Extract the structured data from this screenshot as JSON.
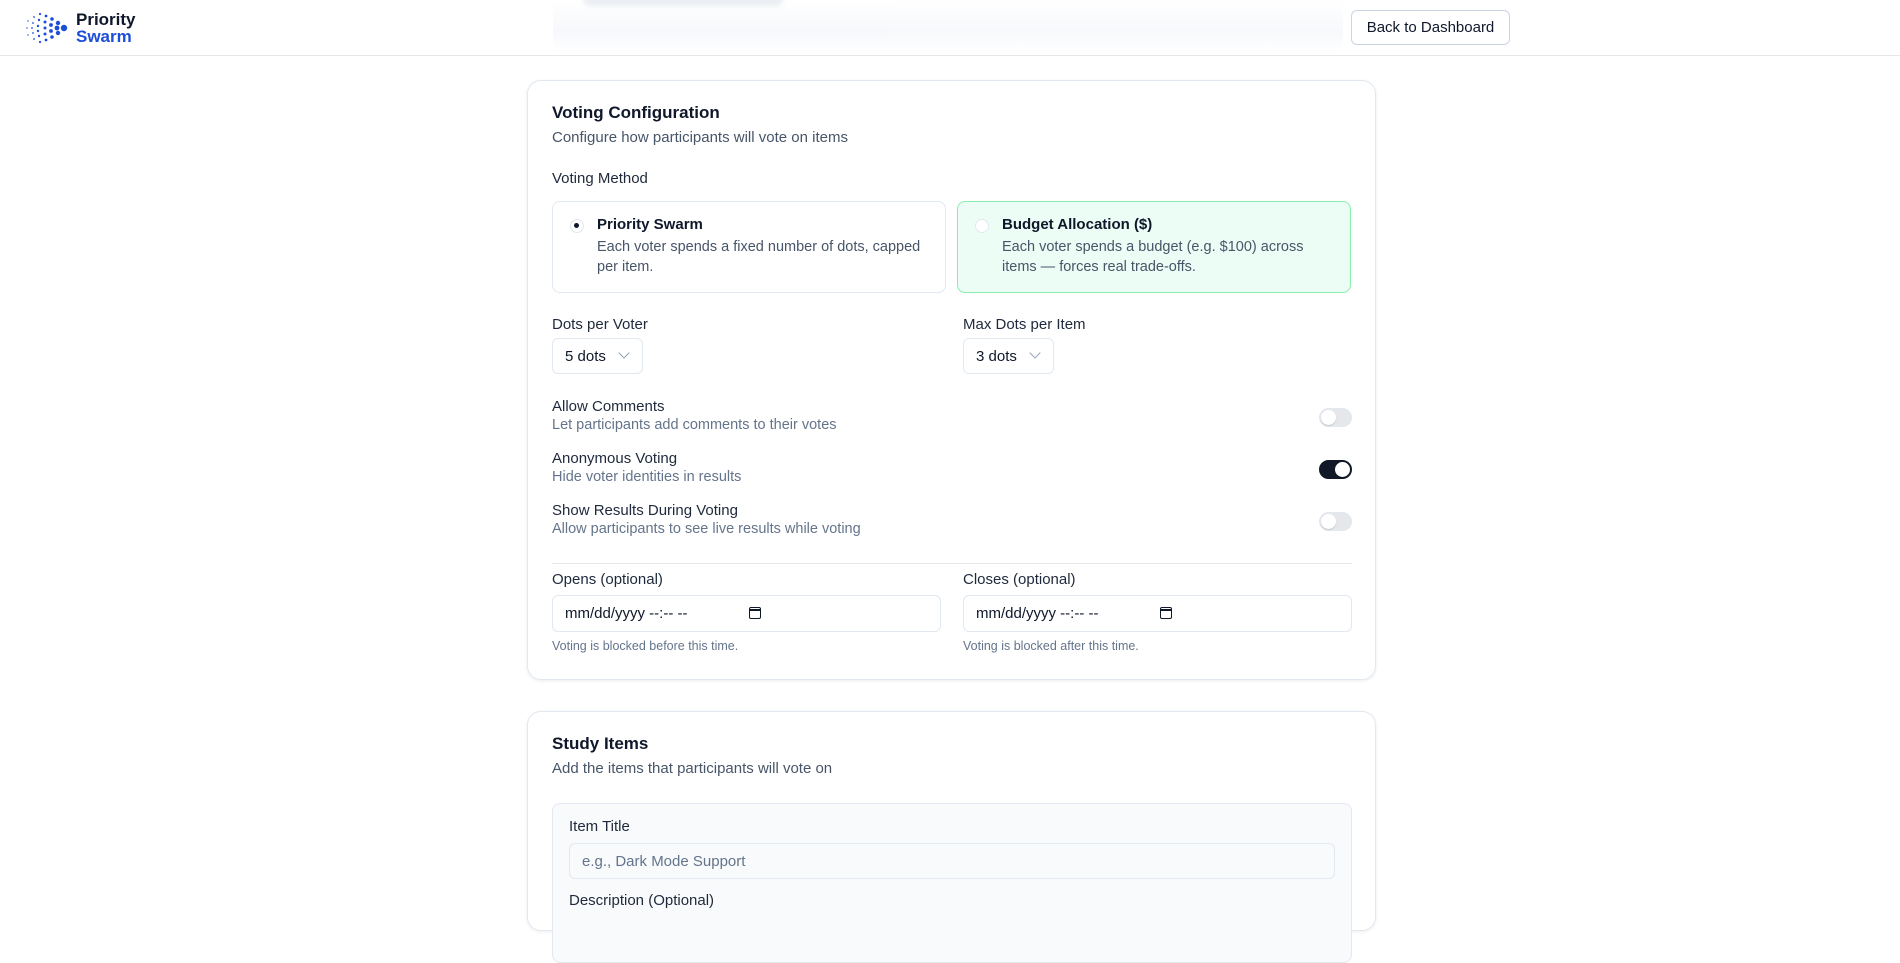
{
  "header": {
    "brand_line1": "Priority",
    "brand_line2": "Swarm",
    "back_button": "Back to Dashboard"
  },
  "voting": {
    "title": "Voting Configuration",
    "subtitle": "Configure how participants will vote on items",
    "method_label": "Voting Method",
    "methods": [
      {
        "title": "Priority Swarm",
        "description": "Each voter spends a fixed number of dots, capped per item.",
        "checked": true
      },
      {
        "title": "Budget Allocation ($)",
        "description": "Each voter spends a budget (e.g. $100) across items — forces real trade-offs.",
        "checked": false
      }
    ],
    "dots_per_voter_label": "Dots per Voter",
    "dots_per_voter_value": "5 dots",
    "max_dots_label": "Max Dots per Item",
    "max_dots_value": "3 dots",
    "options": [
      {
        "title": "Allow Comments",
        "description": "Let participants add comments to their votes",
        "enabled": false
      },
      {
        "title": "Anonymous Voting",
        "description": "Hide voter identities in results",
        "enabled": true
      },
      {
        "title": "Show Results During Voting",
        "description": "Allow participants to see live results while voting",
        "enabled": false
      }
    ],
    "opens_label": "Opens (optional)",
    "opens_value": "mm/dd/yyyy --:-- --",
    "opens_hint": "Voting is blocked before this time.",
    "closes_label": "Closes (optional)",
    "closes_value": "mm/dd/yyyy --:-- --",
    "closes_hint": "Voting is blocked after this time."
  },
  "items": {
    "title": "Study Items",
    "subtitle": "Add the items that participants will vote on",
    "item_title_label": "Item Title",
    "item_title_placeholder": "e.g., Dark Mode Support",
    "description_label": "Description (Optional)"
  },
  "colors": {
    "accent": "#1d4ed8",
    "selected_method_bg": "#ecfdf5",
    "selected_method_border": "#86efac",
    "toggle_on": "#111827"
  }
}
